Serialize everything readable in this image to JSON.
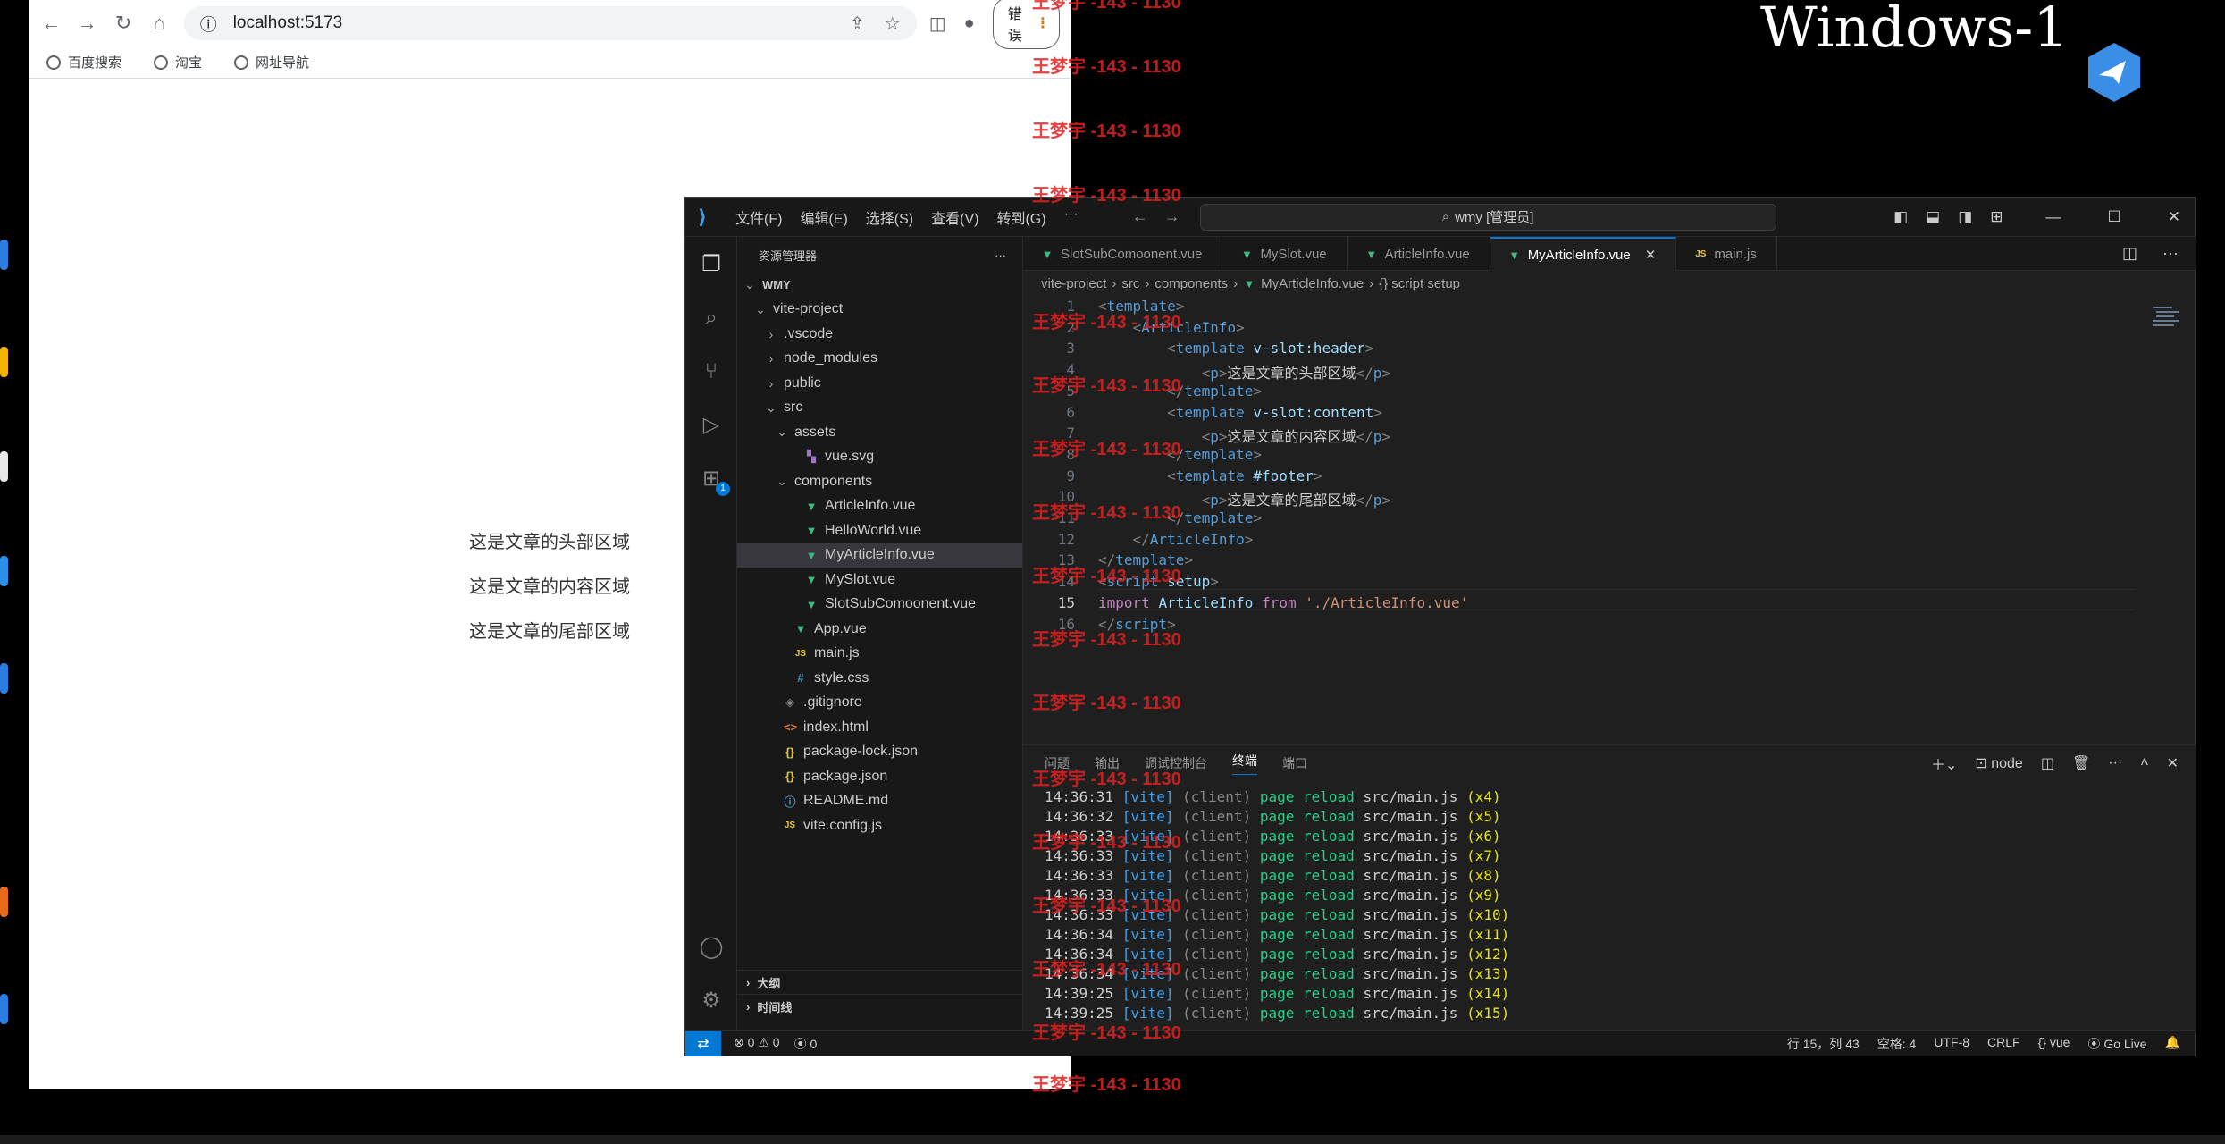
{
  "desktop": {
    "title": "Windows-1"
  },
  "watermark": "王梦宇 -143 - 1130",
  "browser": {
    "url": "localhost:5173",
    "error_button": "错误",
    "bookmarks": [
      {
        "label": "百度搜索"
      },
      {
        "label": "淘宝"
      },
      {
        "label": "网址导航"
      }
    ],
    "content": [
      "这是文章的头部区域",
      "这是文章的内容区域",
      "这是文章的尾部区域"
    ]
  },
  "vscode": {
    "menu": [
      "文件(F)",
      "编辑(E)",
      "选择(S)",
      "查看(V)",
      "转到(G)",
      "···"
    ],
    "search": "wmy [管理员]",
    "explorer_title": "资源管理器",
    "explorer_more": "···",
    "tree": [
      {
        "label": "WMY",
        "chev": "v",
        "indent": 0,
        "icon": "",
        "bold": true
      },
      {
        "label": "vite-project",
        "chev": "v",
        "indent": 1,
        "icon": ""
      },
      {
        "label": ".vscode",
        "chev": ">",
        "indent": 2,
        "icon": ""
      },
      {
        "label": "node_modules",
        "chev": ">",
        "indent": 2,
        "icon": ""
      },
      {
        "label": "public",
        "chev": ">",
        "indent": 2,
        "icon": ""
      },
      {
        "label": "src",
        "chev": "v",
        "indent": 2,
        "icon": ""
      },
      {
        "label": "assets",
        "chev": "v",
        "indent": 3,
        "icon": ""
      },
      {
        "label": "vue.svg",
        "chev": "",
        "indent": 4,
        "icon": "svg"
      },
      {
        "label": "components",
        "chev": "v",
        "indent": 3,
        "icon": ""
      },
      {
        "label": "ArticleInfo.vue",
        "chev": "",
        "indent": 4,
        "icon": "vue"
      },
      {
        "label": "HelloWorld.vue",
        "chev": "",
        "indent": 4,
        "icon": "vue"
      },
      {
        "label": "MyArticleInfo.vue",
        "chev": "",
        "indent": 4,
        "icon": "vue",
        "selected": true
      },
      {
        "label": "MySlot.vue",
        "chev": "",
        "indent": 4,
        "icon": "vue"
      },
      {
        "label": "SlotSubComoonent.vue",
        "chev": "",
        "indent": 4,
        "icon": "vue"
      },
      {
        "label": "App.vue",
        "chev": "",
        "indent": 3,
        "icon": "vue"
      },
      {
        "label": "main.js",
        "chev": "",
        "indent": 3,
        "icon": "js"
      },
      {
        "label": "style.css",
        "chev": "",
        "indent": 3,
        "icon": "css"
      },
      {
        "label": ".gitignore",
        "chev": "",
        "indent": 2,
        "icon": "git"
      },
      {
        "label": "index.html",
        "chev": "",
        "indent": 2,
        "icon": "html"
      },
      {
        "label": "package-lock.json",
        "chev": "",
        "indent": 2,
        "icon": "json"
      },
      {
        "label": "package.json",
        "chev": "",
        "indent": 2,
        "icon": "json"
      },
      {
        "label": "README.md",
        "chev": "",
        "indent": 2,
        "icon": "md"
      },
      {
        "label": "vite.config.js",
        "chev": "",
        "indent": 2,
        "icon": "js"
      }
    ],
    "outline": "大纲",
    "timeline": "时间线",
    "tabs": [
      {
        "label": "SlotSubComoonent.vue",
        "icon": "vue"
      },
      {
        "label": "MySlot.vue",
        "icon": "vue"
      },
      {
        "label": "ArticleInfo.vue",
        "icon": "vue"
      },
      {
        "label": "MyArticleInfo.vue",
        "icon": "vue",
        "active": true
      },
      {
        "label": "main.js",
        "icon": "js"
      }
    ],
    "breadcrumb": [
      "vite-project",
      "src",
      "components",
      "MyArticleInfo.vue",
      "{} script setup"
    ],
    "code": [
      [
        [
          "tg",
          "<"
        ],
        [
          "tn",
          "template"
        ],
        [
          "tg",
          ">"
        ]
      ],
      [
        [
          "tx",
          "    "
        ],
        [
          "tg",
          "<"
        ],
        [
          "tn",
          "ArticleInfo"
        ],
        [
          "tg",
          ">"
        ]
      ],
      [
        [
          "tx",
          "        "
        ],
        [
          "tg",
          "<"
        ],
        [
          "tn",
          "template"
        ],
        [
          "tx",
          " "
        ],
        [
          "at",
          "v-slot:header"
        ],
        [
          "tg",
          ">"
        ]
      ],
      [
        [
          "tx",
          "            "
        ],
        [
          "tg",
          "<"
        ],
        [
          "tn",
          "p"
        ],
        [
          "tg",
          ">"
        ],
        [
          "tx",
          "这是文章的头部区域"
        ],
        [
          "tg",
          "</"
        ],
        [
          "tn",
          "p"
        ],
        [
          "tg",
          ">"
        ]
      ],
      [
        [
          "tx",
          "        "
        ],
        [
          "tg",
          "</"
        ],
        [
          "tn",
          "template"
        ],
        [
          "tg",
          ">"
        ]
      ],
      [
        [
          "tx",
          "        "
        ],
        [
          "tg",
          "<"
        ],
        [
          "tn",
          "template"
        ],
        [
          "tx",
          " "
        ],
        [
          "at",
          "v-slot:content"
        ],
        [
          "tg",
          ">"
        ]
      ],
      [
        [
          "tx",
          "            "
        ],
        [
          "tg",
          "<"
        ],
        [
          "tn",
          "p"
        ],
        [
          "tg",
          ">"
        ],
        [
          "tx",
          "这是文章的内容区域"
        ],
        [
          "tg",
          "</"
        ],
        [
          "tn",
          "p"
        ],
        [
          "tg",
          ">"
        ]
      ],
      [
        [
          "tx",
          "        "
        ],
        [
          "tg",
          "</"
        ],
        [
          "tn",
          "template"
        ],
        [
          "tg",
          ">"
        ]
      ],
      [
        [
          "tx",
          "        "
        ],
        [
          "tg",
          "<"
        ],
        [
          "tn",
          "template"
        ],
        [
          "tx",
          " "
        ],
        [
          "at",
          "#footer"
        ],
        [
          "tg",
          ">"
        ]
      ],
      [
        [
          "tx",
          "            "
        ],
        [
          "tg",
          "<"
        ],
        [
          "tn",
          "p"
        ],
        [
          "tg",
          ">"
        ],
        [
          "tx",
          "这是文章的尾部区域"
        ],
        [
          "tg",
          "</"
        ],
        [
          "tn",
          "p"
        ],
        [
          "tg",
          ">"
        ]
      ],
      [
        [
          "tx",
          "        "
        ],
        [
          "tg",
          "</"
        ],
        [
          "tn",
          "template"
        ],
        [
          "tg",
          ">"
        ]
      ],
      [
        [
          "tx",
          "    "
        ],
        [
          "tg",
          "</"
        ],
        [
          "tn",
          "ArticleInfo"
        ],
        [
          "tg",
          ">"
        ]
      ],
      [
        [
          "tg",
          "</"
        ],
        [
          "tn",
          "template"
        ],
        [
          "tg",
          ">"
        ]
      ],
      [
        [
          "tg",
          "<"
        ],
        [
          "tn",
          "script"
        ],
        [
          "tx",
          " "
        ],
        [
          "at",
          "setup"
        ],
        [
          "tg",
          ">"
        ]
      ],
      [
        [
          "kw",
          "import"
        ],
        [
          "tx",
          " "
        ],
        [
          "id",
          "ArticleInfo"
        ],
        [
          "tx",
          " "
        ],
        [
          "kw",
          "from"
        ],
        [
          "tx",
          " "
        ],
        [
          "st",
          "'./ArticleInfo.vue'"
        ]
      ],
      [
        [
          "tg",
          "</"
        ],
        [
          "tn",
          "script"
        ],
        [
          "tg",
          ">"
        ]
      ]
    ],
    "panel_tabs": [
      "问题",
      "输出",
      "调试控制台",
      "终端",
      "端口"
    ],
    "panel_active": "终端",
    "panel_terminal_name": "node",
    "terminal": [
      [
        "14:36:31",
        "(x4)"
      ],
      [
        "14:36:32",
        "(x5)"
      ],
      [
        "14:36:33",
        "(x6)"
      ],
      [
        "14:36:33",
        "(x7)"
      ],
      [
        "14:36:33",
        "(x8)"
      ],
      [
        "14:36:33",
        "(x9)"
      ],
      [
        "14:36:33",
        "(x10)"
      ],
      [
        "14:36:34",
        "(x11)"
      ],
      [
        "14:36:34",
        "(x12)"
      ],
      [
        "14:36:34",
        "(x13)"
      ],
      [
        "14:39:25",
        "(x14)"
      ],
      [
        "14:39:25",
        "(x15)"
      ]
    ],
    "terminal_tokens": {
      "vite": "[vite]",
      "client": "(client)",
      "action": "page reload",
      "file": "src/main.js"
    },
    "status": {
      "errors": "0",
      "warnings": "0",
      "ports": "0",
      "position": "行 15，列 43",
      "spaces": "空格: 4",
      "encoding": "UTF-8",
      "eol": "CRLF",
      "lang": "vue",
      "golive": "Go Live"
    }
  }
}
